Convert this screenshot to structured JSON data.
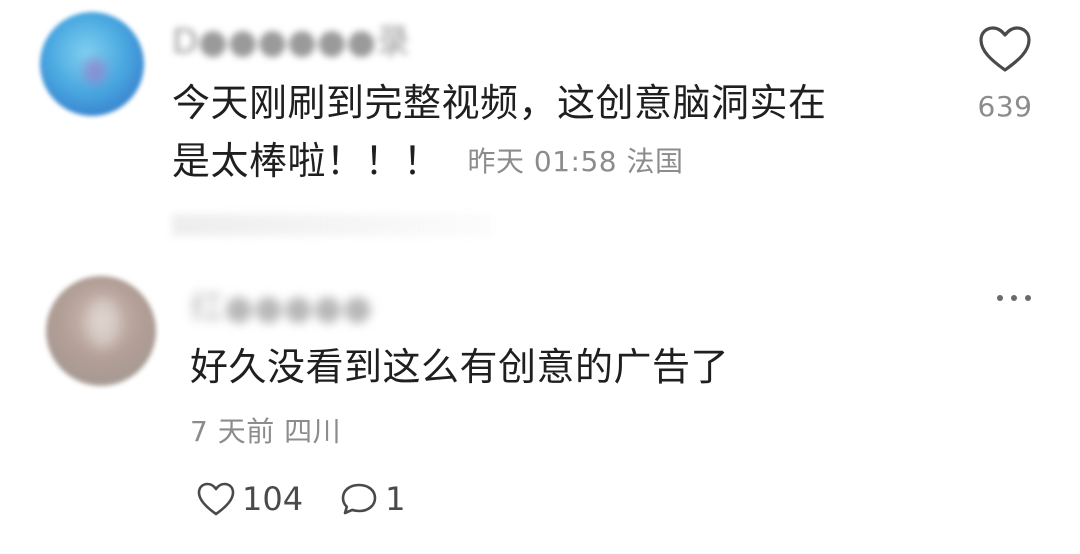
{
  "comments": [
    {
      "username": "D●●●●●●录",
      "content_line1": "今天刚刷到完整视频，这创意脑洞实在",
      "content_line2": "是太棒啦！！！",
      "time": "昨天 01:58",
      "location": "法国",
      "likes": "639"
    },
    {
      "username": "红●●●●●",
      "content": "好久没看到这么有创意的广告了",
      "time": "7 天前",
      "location": "四川",
      "likes": "104",
      "replies": "1"
    }
  ],
  "icons": {
    "like": "heart-icon",
    "reply": "comment-bubble-icon",
    "more": "more-dots-icon"
  },
  "colors": {
    "text_primary": "#1f1f1f",
    "text_secondary": "#8c8c8c",
    "icon": "#4a4a4a"
  }
}
